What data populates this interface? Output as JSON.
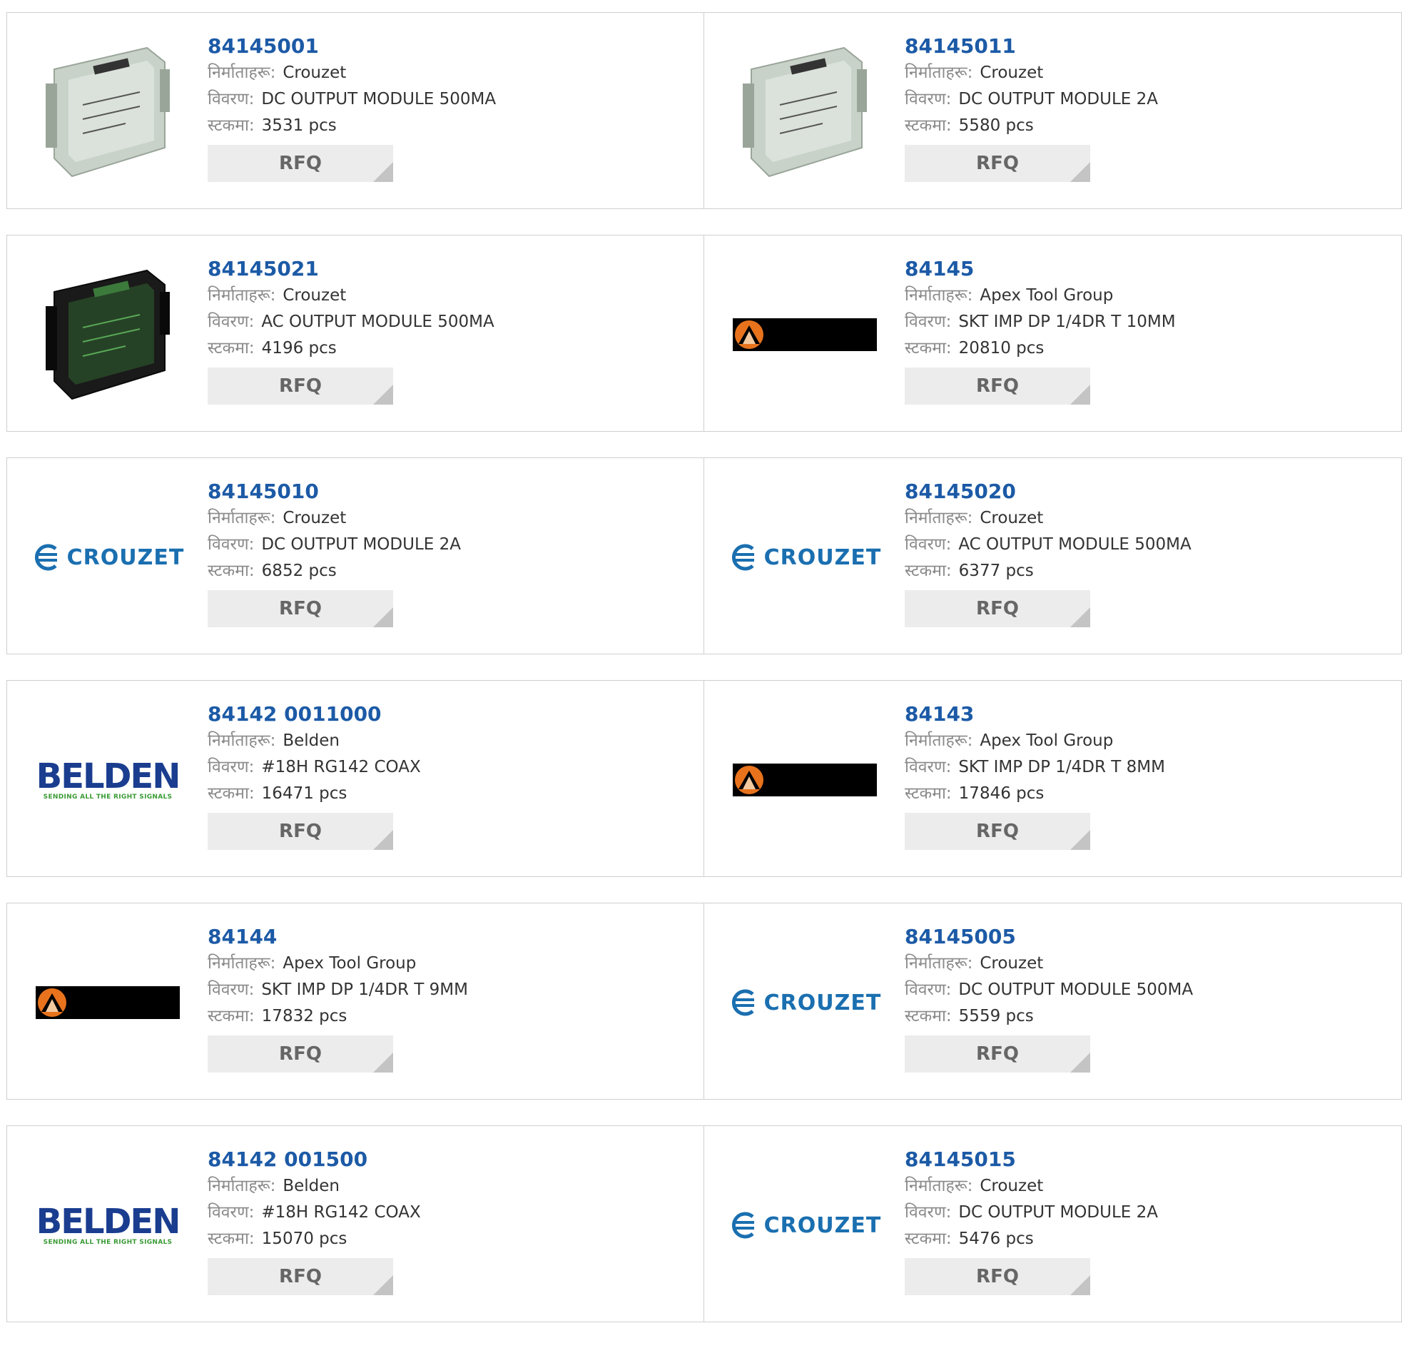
{
  "labels": {
    "manufacturer": "निर्माताहरू:",
    "description": "विवरण:",
    "stock": "स्टकमा:"
  },
  "products": [
    {
      "pn": "84145001",
      "manufacturer": "Crouzet",
      "description": "DC OUTPUT MODULE 500MA",
      "stock": "3531 pcs",
      "image": "module-photo-gray",
      "rfq": "RFQ"
    },
    {
      "pn": "84145011",
      "manufacturer": "Crouzet",
      "description": "DC OUTPUT MODULE 2A",
      "stock": "5580 pcs",
      "image": "module-photo-gray",
      "rfq": "RFQ"
    },
    {
      "pn": "84145021",
      "manufacturer": "Crouzet",
      "description": "AC OUTPUT MODULE 500MA",
      "stock": "4196 pcs",
      "image": "module-photo-black",
      "rfq": "RFQ"
    },
    {
      "pn": "84145",
      "manufacturer": "Apex Tool Group",
      "description": "SKT IMP DP 1/4DR T 10MM",
      "stock": "20810 pcs",
      "image": "apex-logo",
      "rfq": "RFQ"
    },
    {
      "pn": "84145010",
      "manufacturer": "Crouzet",
      "description": "DC OUTPUT MODULE 2A",
      "stock": "6852 pcs",
      "image": "crouzet-logo",
      "rfq": "RFQ"
    },
    {
      "pn": "84145020",
      "manufacturer": "Crouzet",
      "description": "AC OUTPUT MODULE 500MA",
      "stock": "6377 pcs",
      "image": "crouzet-logo",
      "rfq": "RFQ"
    },
    {
      "pn": "84142 0011000",
      "manufacturer": "Belden",
      "description": "#18H RG142 COAX",
      "stock": "16471 pcs",
      "image": "belden-logo",
      "rfq": "RFQ"
    },
    {
      "pn": "84143",
      "manufacturer": "Apex Tool Group",
      "description": "SKT IMP DP 1/4DR T 8MM",
      "stock": "17846 pcs",
      "image": "apex-logo",
      "rfq": "RFQ"
    },
    {
      "pn": "84144",
      "manufacturer": "Apex Tool Group",
      "description": "SKT IMP DP 1/4DR T 9MM",
      "stock": "17832 pcs",
      "image": "apex-logo",
      "rfq": "RFQ"
    },
    {
      "pn": "84145005",
      "manufacturer": "Crouzet",
      "description": "DC OUTPUT MODULE 500MA",
      "stock": "5559 pcs",
      "image": "crouzet-logo",
      "rfq": "RFQ"
    },
    {
      "pn": "84142 001500",
      "manufacturer": "Belden",
      "description": "#18H RG142 COAX",
      "stock": "15070 pcs",
      "image": "belden-logo",
      "rfq": "RFQ"
    },
    {
      "pn": "84145015",
      "manufacturer": "Crouzet",
      "description": "DC OUTPUT MODULE 2A",
      "stock": "5476 pcs",
      "image": "crouzet-logo",
      "rfq": "RFQ"
    }
  ],
  "logos": {
    "crouzet": "CROUZET",
    "belden": "BELDEN",
    "belden_tagline": "SENDING ALL THE RIGHT SIGNALS"
  },
  "colors": {
    "link": "#1c5aa6",
    "button_bg": "#ececec",
    "border": "#cfcfcf"
  }
}
